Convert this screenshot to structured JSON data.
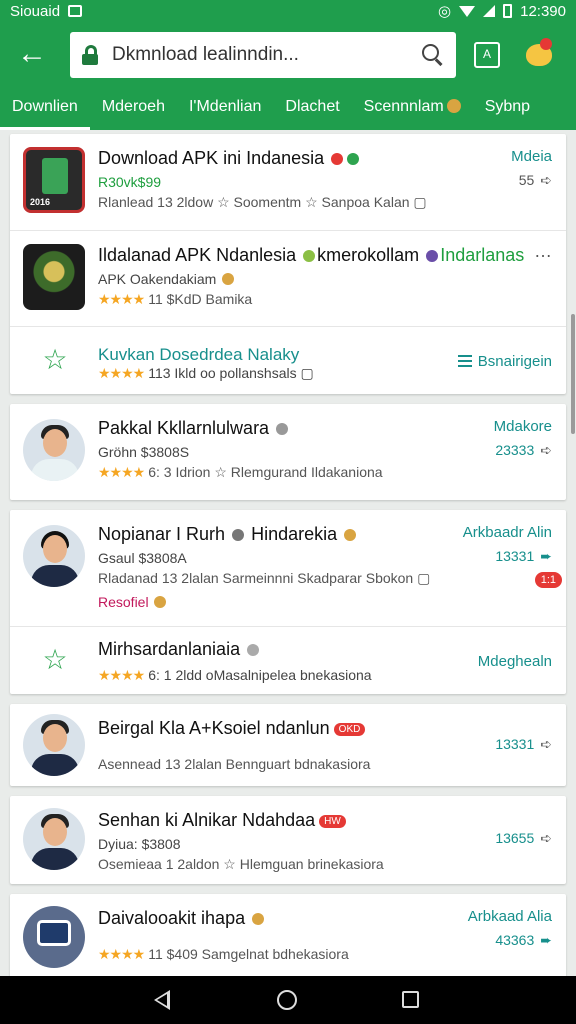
{
  "status": {
    "left_text": "Siouaid",
    "time": "12:390"
  },
  "search": {
    "value": "Dkmnload lealinndin..."
  },
  "tabs": [
    {
      "label": "Downlien"
    },
    {
      "label": "Mderoeh"
    },
    {
      "label": "I'Mdenlian"
    },
    {
      "label": "Dlachet"
    },
    {
      "label": "Scennnlam"
    },
    {
      "label": "Sybnp"
    }
  ],
  "apk_icon_text": "A",
  "items": [
    {
      "title": "Download APK ini Indanesia",
      "sub1": "R30vk$99",
      "sub2": "Rlanlead 13 2ldow ☆ Soomentm ☆ Sanpoa Kalan",
      "right1": "Mdeia",
      "right2": "55"
    },
    {
      "title": "Ildalanad APK Ndanlesia",
      "title_extra": "kmerokollam",
      "title_extra2": "Indarlanas",
      "sub1": "APK Oakendakiam",
      "sub1_dark": true,
      "sub2": "11 $KdD  Bamika"
    },
    {
      "title": "Kuvkan Dosedrdea Nalaky",
      "sub2": "113 Ikld oo pollanshsals",
      "right1": "Bsnairigein"
    },
    {
      "title": "Pakkal Kkllarnlulwara",
      "sub1": "Gröhn  $3808S",
      "sub2": "6: 3 Idrion ☆ Rlemgurand Ildakaniona",
      "right1": "Mdakore",
      "right2": "23333"
    },
    {
      "title": "Nopianar I Rurh",
      "title_extra": "Hindarekia",
      "sub1": "Gsaul  $3808A",
      "sub2": "Rladanad 13 2lalan  Sarmeinnni  Skadparar Sbokon",
      "sub3": "Resofiel",
      "right1": "Arkbaadr Alin",
      "right2": "13331",
      "pill": "1:1"
    },
    {
      "title": "Mirhsardanlaniaia",
      "sub2": "6: 1 2ldd oMasalnipelea bnekasiona",
      "right1": "Mdeghealn"
    },
    {
      "title": "Beirgal Kla A+Ksoiel ndanlun",
      "badge": "OKD",
      "sub2": "Asennead 13 2lalan  Bennguart bdnakasiora",
      "right2": "13331"
    },
    {
      "title": "Senhan ki Alnikar Ndahdaa",
      "badge": "HW",
      "sub1": "Dyiua: $3808",
      "sub2": "Osemieaa 1 2aldon ☆ Hlemguan brinekasiora",
      "right2": "13655"
    },
    {
      "title": "Daivalooakit ihapa",
      "sub2": "11 $409  Samgelnat bdhekasiora",
      "right1": "Arbkaad Alia",
      "right2": "43363"
    }
  ],
  "thumb_labels": {
    "first": "2016"
  },
  "colors": {
    "primary": "#1f9e4d",
    "accent": "#178f8c",
    "star": "#f5a623"
  }
}
